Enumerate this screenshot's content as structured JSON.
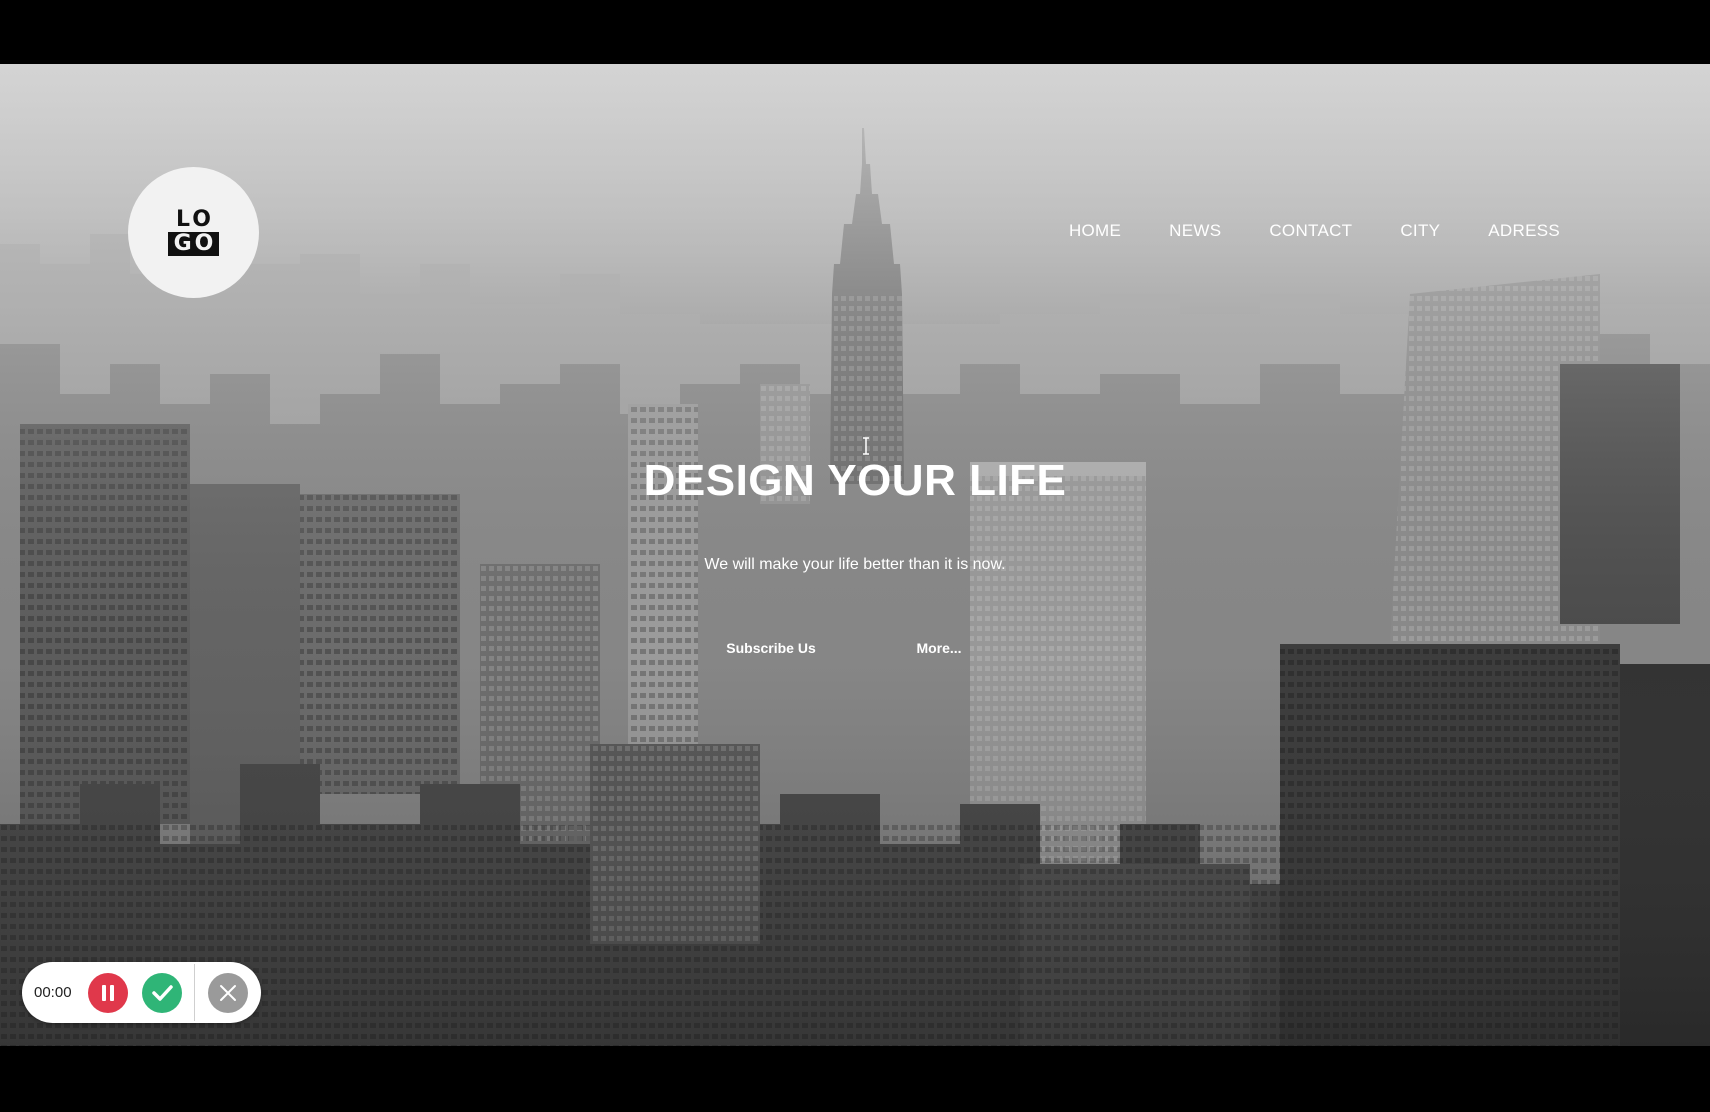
{
  "logo": {
    "line1": "LO",
    "line2": "GO"
  },
  "nav": {
    "items": [
      {
        "label": "HOME"
      },
      {
        "label": "NEWS"
      },
      {
        "label": "CONTACT"
      },
      {
        "label": "CITY"
      },
      {
        "label": "ADRESS"
      }
    ]
  },
  "hero": {
    "title": "DESIGN YOUR LIFE",
    "subtitle": "We will make your life better than it is now.",
    "subscribe_label": "Subscribe Us",
    "more_label": "More..."
  },
  "recorder": {
    "time": "00:00",
    "colors": {
      "pause": "#e0384b",
      "done": "#2fb577",
      "close": "#9a9a9a"
    }
  }
}
